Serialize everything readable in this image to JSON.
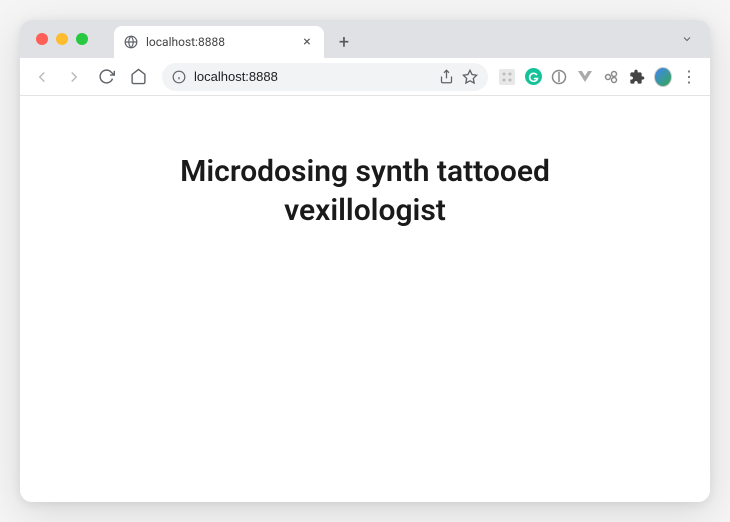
{
  "window": {
    "tab_title": "localhost:8888",
    "url": "localhost:8888"
  },
  "content": {
    "heading": "Microdosing synth tattooed vexillologist"
  },
  "icons": {
    "new_tab": "+",
    "close_tab": "×",
    "menu_dots": "⋮"
  }
}
